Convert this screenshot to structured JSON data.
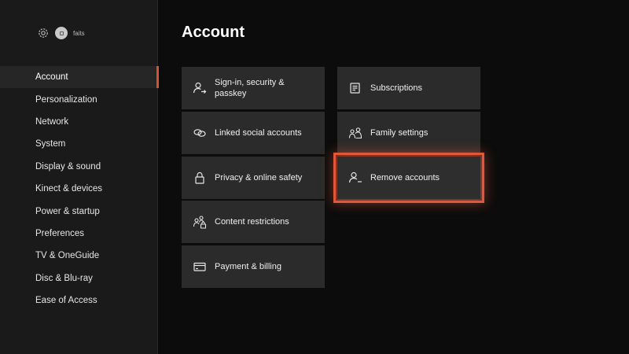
{
  "profile": {
    "gamertag": "faits",
    "settings_icon": "gear-icon"
  },
  "page": {
    "title": "Account"
  },
  "sidebar": {
    "active_index": 0,
    "items": [
      {
        "label": "Account"
      },
      {
        "label": "Personalization"
      },
      {
        "label": "Network"
      },
      {
        "label": "System"
      },
      {
        "label": "Display & sound"
      },
      {
        "label": "Kinect & devices"
      },
      {
        "label": "Power & startup"
      },
      {
        "label": "Preferences"
      },
      {
        "label": "TV & OneGuide"
      },
      {
        "label": "Disc & Blu-ray"
      },
      {
        "label": "Ease of Access"
      }
    ]
  },
  "tiles": {
    "signin": {
      "label": "Sign-in, security & passkey",
      "icon": "person-arrow-icon"
    },
    "linked": {
      "label": "Linked social accounts",
      "icon": "link-icon"
    },
    "privacy": {
      "label": "Privacy & online safety",
      "icon": "lock-icon"
    },
    "content": {
      "label": "Content restrictions",
      "icon": "family-lock-icon"
    },
    "payment": {
      "label": "Payment & billing",
      "icon": "card-icon"
    },
    "subscriptions": {
      "label": "Subscriptions",
      "icon": "list-icon"
    },
    "family": {
      "label": "Family settings",
      "icon": "family-icon"
    },
    "remove": {
      "label": "Remove accounts",
      "icon": "person-minus-icon",
      "focused": true
    }
  },
  "colors": {
    "background": "#0c0c0c",
    "sidebar": "#1a1a1a",
    "tile": "#2b2b2b",
    "focus_highlight": "#e0573a"
  }
}
